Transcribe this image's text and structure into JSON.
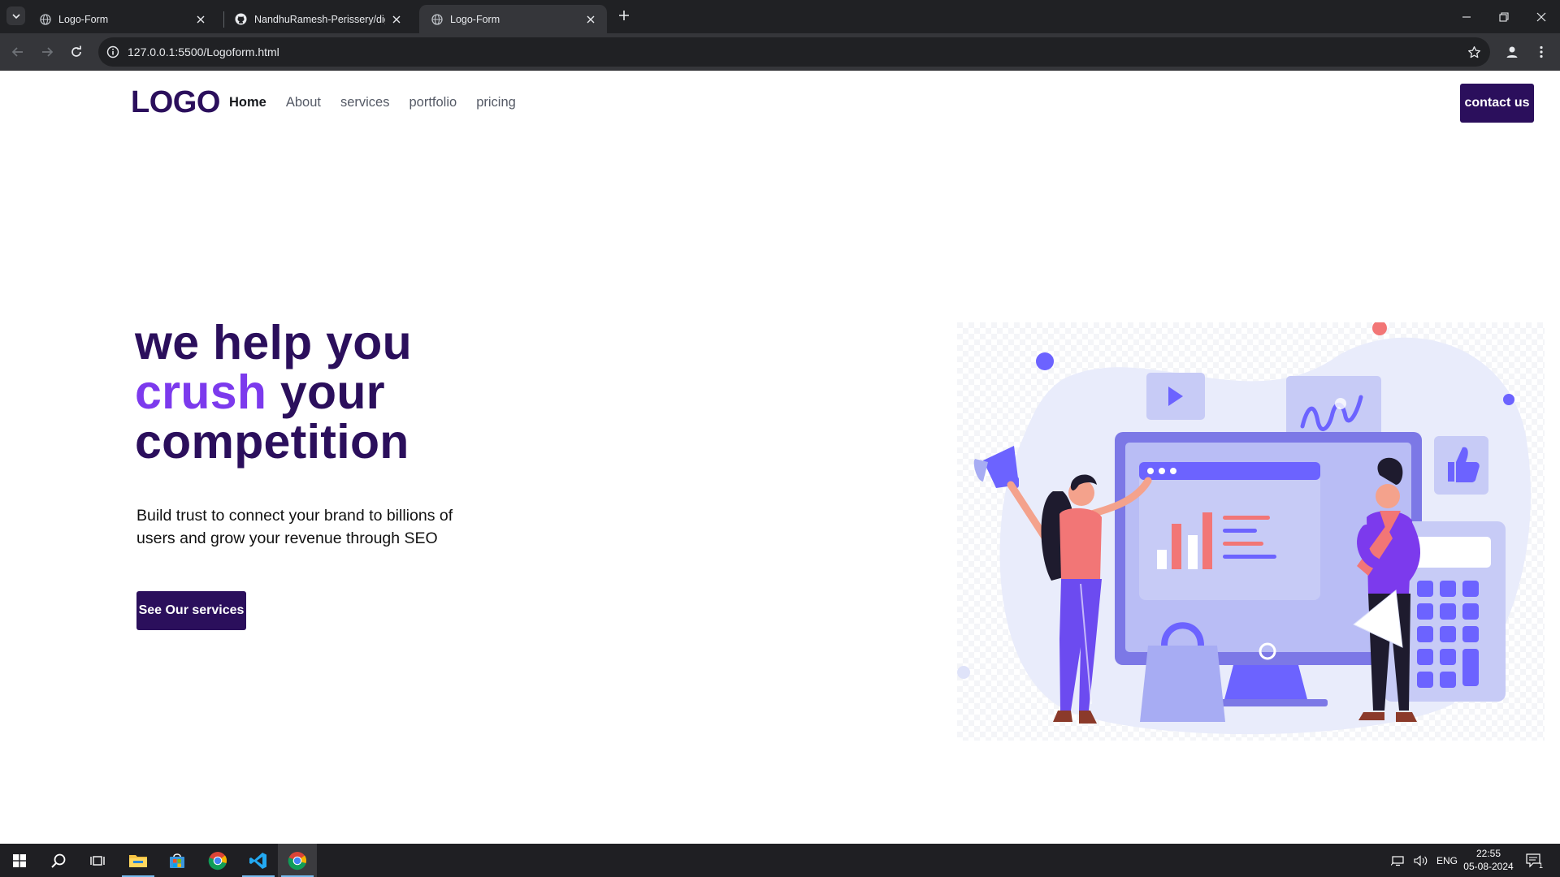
{
  "browser": {
    "tabs": [
      {
        "title": "Logo-Form",
        "active": false
      },
      {
        "title": "NandhuRamesh-Perissery/digit",
        "active": false
      },
      {
        "title": "Logo-Form",
        "active": true
      }
    ],
    "url": "127.0.0.1:5500/Logoform.html"
  },
  "page": {
    "logo": "LOGO",
    "nav": [
      {
        "label": "Home",
        "active": true
      },
      {
        "label": "About",
        "active": false
      },
      {
        "label": "services",
        "active": false
      },
      {
        "label": "portfolio",
        "active": false
      },
      {
        "label": "pricing",
        "active": false
      }
    ],
    "contact_button": "contact us",
    "hero": {
      "line1": "we help you",
      "line2_accent": "crush",
      "line2_rest": " your",
      "line3": "competition",
      "subtitle": "Build trust to connect your brand to billions of users and grow your revenue through SEO",
      "cta": "See Our services"
    },
    "colors": {
      "brand": "#2b0f5c",
      "accent": "#7c3aed",
      "illustration_primary": "#6c63ff",
      "illustration_light": "#e9ecfb",
      "illustration_coral": "#f27676"
    }
  },
  "taskbar": {
    "apps": [
      "windows-start-icon",
      "search-icon",
      "task-view-icon",
      "file-explorer-icon",
      "microsoft-store-icon",
      "chrome-icon",
      "vscode-icon",
      "chrome-icon"
    ],
    "language": "ENG",
    "time": "22:55",
    "date": "05-08-2024",
    "notification_count": "1"
  }
}
